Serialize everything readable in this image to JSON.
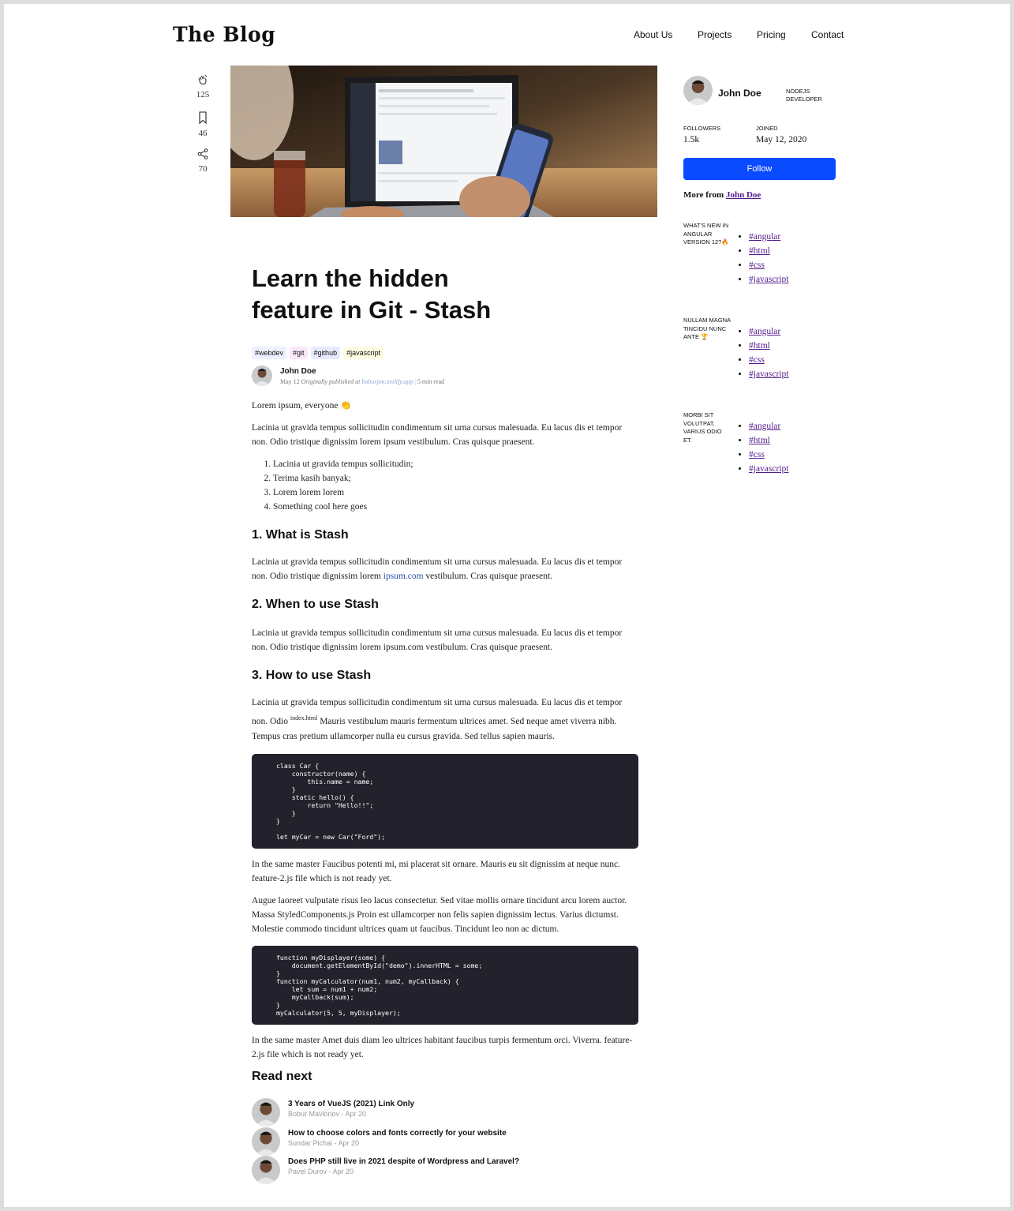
{
  "header": {
    "logo": "The Blog",
    "nav": [
      "About Us",
      "Projects",
      "Pricing",
      "Contact"
    ]
  },
  "rail": {
    "clap_count": "125",
    "bookmark_count": "46",
    "share_count": "70"
  },
  "article": {
    "title": "Learn the hidden feature in Git - Stash",
    "tags": [
      "#webdev",
      "#git",
      "#github",
      "#javascript"
    ],
    "tag_colors": [
      "#eef0ff",
      "#fbe8fb",
      "#e9eafd",
      "#fdfbe2"
    ],
    "author": {
      "name": "John Doe",
      "date": "May 12",
      "published_prefix": "Originally published at",
      "published_link": "boburjon.netlify.app",
      "read_time": "5 min read"
    },
    "intro": "Lorem ipsum, everyone 👏",
    "para1": "Lacinia ut gravida tempus sollicitudin condimentum sit urna cursus malesuada. Eu lacus dis et tempor non. Odio tristique dignissim lorem ipsum vestibulum. Cras quisque praesent.",
    "list": [
      "Lacinia ut gravida tempus sollicitudin;",
      "Terima kasih banyak;",
      "Lorem lorem lorem",
      "Something cool here goes"
    ],
    "sections": [
      {
        "heading": "1. What is Stash",
        "text_before_link": "Lacinia ut gravida tempus sollicitudin condimentum sit urna cursus malesuada. Eu lacus dis et tempor non. Odio tristique dignissim lorem ",
        "link": "ipsum.com",
        "text_after_link": " vestibulum. Cras quisque praesent."
      },
      {
        "heading": "2. When to use Stash",
        "text": "Lacinia ut gravida tempus sollicitudin condimentum sit urna cursus malesuada. Eu lacus dis et tempor non. Odio tristique dignissim lorem ipsum.com vestibulum. Cras quisque praesent."
      },
      {
        "heading": "3. How to use Stash",
        "text_before_sup": "Lacinia ut gravida tempus sollicitudin condimentum sit urna cursus malesuada. Eu lacus dis et tempor non. Odio ",
        "sup": "index.html",
        "text_after_sup": " Mauris vestibulum mauris fermentum ultrices amet. Sed neque amet viverra nibh. Tempus cras pretium ullamcorper nulla eu cursus gravida. Sed tellus sapien mauris."
      }
    ],
    "code1": "class Car {\n    constructor(name) {\n        this.name = name;\n    }\n    static hello() {\n        return \"Hello!!\";\n    }\n}\n\nlet myCar = new Car(\"Ford\");",
    "para_after_code1": "In the same master Faucibus potenti mi, mi placerat sit ornare. Mauris eu sit dignissim at neque nunc. feature-2.js file which is not ready yet.",
    "para_before_code2": "Augue laoreet vulputate risus leo lacus consectetur. Sed vitae mollis ornare tincidunt arcu lorem auctor. Massa StyledComponents.js Proin est ullamcorper non felis sapien dignissim lectus. Varius dictumst. Molestie commodo tincidunt ultrices quam ut faucibus. Tincidunt leo non ac dictum.",
    "code2": "function myDisplayer(some) {\n    document.getElementById(\"demo\").innerHTML = some;\n}\nfunction myCalculator(num1, num2, myCallback) {\n    let sum = num1 + num2;\n    myCallback(sum);\n}\nmyCalculator(5, 5, myDisplayer);",
    "para_after_code2": "In the same master Amet duis diam leo ultrices habitant faucibus turpis fermentum orci. Viverra. feature-2.js file which is not ready yet."
  },
  "read_next": {
    "heading": "Read next",
    "items": [
      {
        "title": "3 Years of VueJS (2021) Link Only",
        "sub": "Bobur Mavlonov - Apr 20"
      },
      {
        "title": "How to choose colors and fonts correctly for your website",
        "sub": "Sundar Pichai - Apr 20"
      },
      {
        "title": "Does PHP still live in 2021 despite of Wordpress and Laravel?",
        "sub": "Pavel Durov - Apr 20"
      }
    ]
  },
  "sidebar": {
    "name": "John Doe",
    "role": "NODEJS DEVELOPER",
    "followers_label": "FOLLOWERS",
    "followers": "1.5k",
    "joined_label": "JOINED",
    "joined": "May 12, 2020",
    "follow_button": "Follow",
    "more_from_label": "More from",
    "more_from_link": "John Doe",
    "posts": [
      {
        "title": "What's new in Angular version 12?🔥",
        "tags": [
          "#angular",
          "#html",
          "#css",
          "#javascript"
        ]
      },
      {
        "title": "Nullam magna tincidu nunc ante 🏆",
        "tags": [
          "#angular",
          "#html",
          "#css",
          "#javascript"
        ]
      },
      {
        "title": "Morbi sit volutpat, varius odio et.",
        "tags": [
          "#angular",
          "#html",
          "#css",
          "#javascript"
        ]
      }
    ],
    "follow_color": "#0a4bff"
  }
}
